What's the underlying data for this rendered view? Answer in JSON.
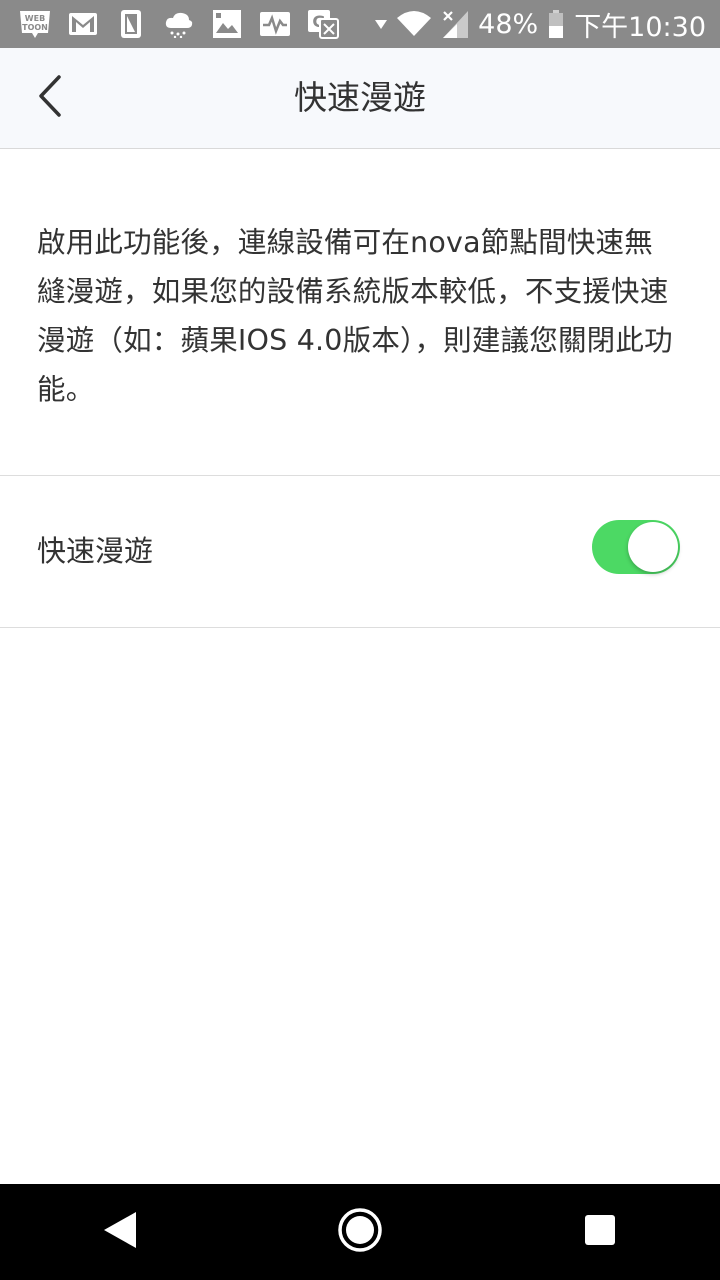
{
  "status_bar": {
    "left_icons": [
      "webtoon-icon",
      "gmail-icon",
      "sim-card-icon",
      "weather-icon",
      "image-icon",
      "activity-icon",
      "translate-icon"
    ],
    "right_icons": [
      "data-arrow-icon",
      "wifi-icon",
      "signal-icon",
      "battery-icon"
    ],
    "battery_percent": "48%",
    "time": "下午10:30",
    "background": "#8a8a8a"
  },
  "header": {
    "back_icon": "chevron-left-icon",
    "title": "快速漫遊"
  },
  "description": "啟用此功能後，連線設備可在nova節點間快速無縫漫遊，如果您的設備系統版本較低，不支援快速漫遊（如：蘋果IOS 4.0版本），則建議您關閉此功能。",
  "setting": {
    "label": "快速漫遊",
    "enabled": true,
    "toggle_color": "#4cd964"
  },
  "nav_bar": {
    "buttons": [
      "back-triangle-icon",
      "home-circle-icon",
      "recents-square-icon"
    ]
  }
}
